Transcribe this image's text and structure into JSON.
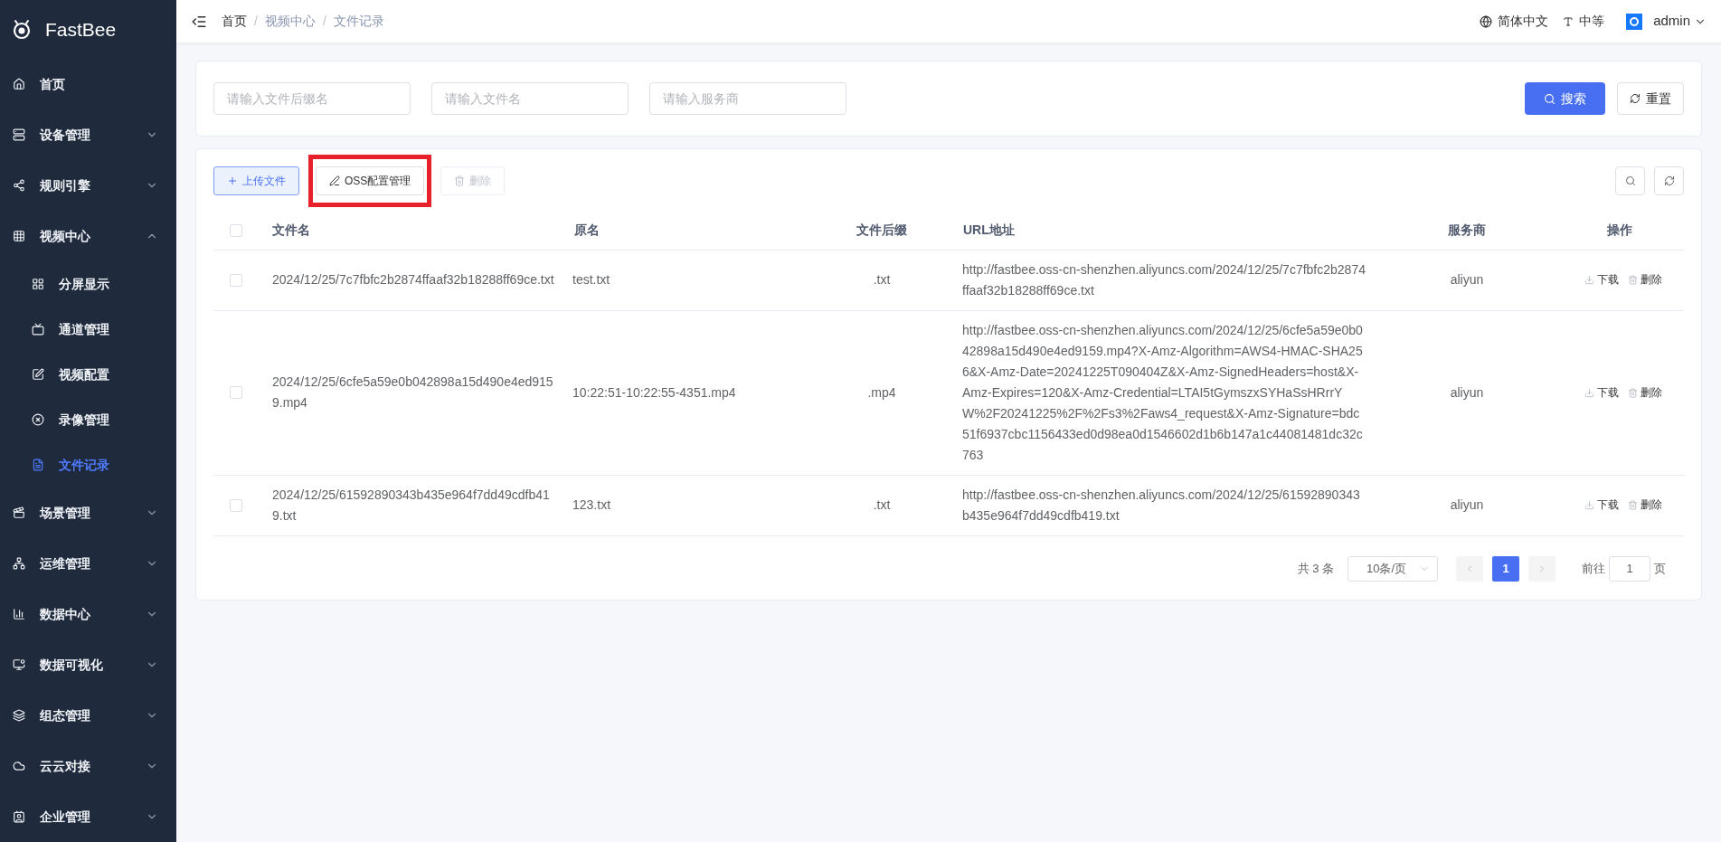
{
  "sidebar": {
    "logo_text": "FastBee",
    "items": [
      {
        "label": "首页",
        "kind": "link",
        "selected": false
      },
      {
        "label": "设备管理",
        "kind": "group",
        "expanded": false,
        "selected": false
      },
      {
        "label": "规则引擎",
        "kind": "group",
        "expanded": false,
        "selected": false
      },
      {
        "label": "视频中心",
        "kind": "group",
        "expanded": true,
        "selected": false,
        "children": [
          {
            "label": "分屏显示",
            "selected": false
          },
          {
            "label": "通道管理",
            "selected": false
          },
          {
            "label": "视频配置",
            "selected": false
          },
          {
            "label": "录像管理",
            "selected": false
          },
          {
            "label": "文件记录",
            "selected": true
          }
        ]
      },
      {
        "label": "场景管理",
        "kind": "group",
        "expanded": false,
        "selected": false
      },
      {
        "label": "运维管理",
        "kind": "group",
        "expanded": false,
        "selected": false
      },
      {
        "label": "数据中心",
        "kind": "group",
        "expanded": false,
        "selected": false
      },
      {
        "label": "数据可视化",
        "kind": "group",
        "expanded": false,
        "selected": false
      },
      {
        "label": "组态管理",
        "kind": "group",
        "expanded": false,
        "selected": false
      },
      {
        "label": "云云对接",
        "kind": "group",
        "expanded": false,
        "selected": false
      },
      {
        "label": "企业管理",
        "kind": "group",
        "expanded": false,
        "selected": false
      }
    ]
  },
  "header": {
    "breadcrumb": [
      {
        "label": "首页",
        "link": true
      },
      {
        "label": "视频中心",
        "link": false
      },
      {
        "label": "文件记录",
        "link": false
      }
    ],
    "separator": "/",
    "language": "简体中文",
    "size": "中等",
    "user": "admin"
  },
  "search": {
    "fields": [
      {
        "placeholder": "请输入文件后缀名"
      },
      {
        "placeholder": "请输入文件名"
      },
      {
        "placeholder": "请输入服务商"
      }
    ],
    "buttons": [
      {
        "label": "搜索",
        "kind": "primary"
      },
      {
        "label": "重置",
        "kind": "default"
      }
    ]
  },
  "toolbar": {
    "buttons": [
      {
        "label": "上传文件",
        "kind": "upload",
        "disabled": false,
        "highlighted": false
      },
      {
        "label": "OSS配置管理",
        "kind": "edit",
        "disabled": false,
        "highlighted": true
      },
      {
        "label": "删除",
        "kind": "delete",
        "disabled": true,
        "highlighted": false
      }
    ]
  },
  "table": {
    "select_all": {
      "checked": false
    },
    "columns": [
      "文件名",
      "原名",
      "文件后缀",
      "URL地址",
      "服务商",
      "操作"
    ],
    "rows": [
      {
        "checked": false,
        "file_name": "2024/12/25/7c7fbfc2b2874ffaaf32b18288ff69ce.txt",
        "original_name": "test.txt",
        "suffix": ".txt",
        "url": "http://fastbee.oss-cn-shenzhen.aliyuncs.com/2024/12/25/7c7fbfc2b2874ffaaf32b18288ff69ce.txt",
        "vendor": "aliyun",
        "actions": [
          {
            "label": "下载",
            "kind": "download"
          },
          {
            "label": "删除",
            "kind": "delete"
          }
        ]
      },
      {
        "checked": false,
        "file_name": "2024/12/25/6cfe5a59e0b042898a15d490e4ed9159.mp4",
        "original_name": "10:22:51-10:22:55-4351.mp4",
        "suffix": ".mp4",
        "url": "http://fastbee.oss-cn-shenzhen.aliyuncs.com/2024/12/25/6cfe5a59e0b042898a15d490e4ed9159.mp4?X-Amz-Algorithm=AWS4-HMAC-SHA256&X-Amz-Date=20241225T090404Z&X-Amz-SignedHeaders=host&X-Amz-Expires=120&X-Amz-Credential=LTAI5tGymszxSYHaSsHRrrYW%2F20241225%2F%2Fs3%2Faws4_request&X-Amz-Signature=bdc51f6937cbc1156433ed0d98ea0d1546602d1b6b147a1c44081481dc32c763",
        "vendor": "aliyun",
        "actions": [
          {
            "label": "下载",
            "kind": "download"
          },
          {
            "label": "删除",
            "kind": "delete"
          }
        ]
      },
      {
        "checked": false,
        "file_name": "2024/12/25/61592890343b435e964f7dd49cdfb419.txt",
        "original_name": "123.txt",
        "suffix": ".txt",
        "url": "http://fastbee.oss-cn-shenzhen.aliyuncs.com/2024/12/25/61592890343b435e964f7dd49cdfb419.txt",
        "vendor": "aliyun",
        "actions": [
          {
            "label": "下载",
            "kind": "download"
          },
          {
            "label": "删除",
            "kind": "delete"
          }
        ]
      }
    ]
  },
  "pagination": {
    "total": "共 3 条",
    "page_size": "10条/页",
    "prev_disabled": true,
    "next_disabled": true,
    "pages": [
      {
        "label": "1",
        "selected": true
      }
    ],
    "goto_label": "前往",
    "goto_value": "1",
    "goto_suffix": "页"
  }
}
